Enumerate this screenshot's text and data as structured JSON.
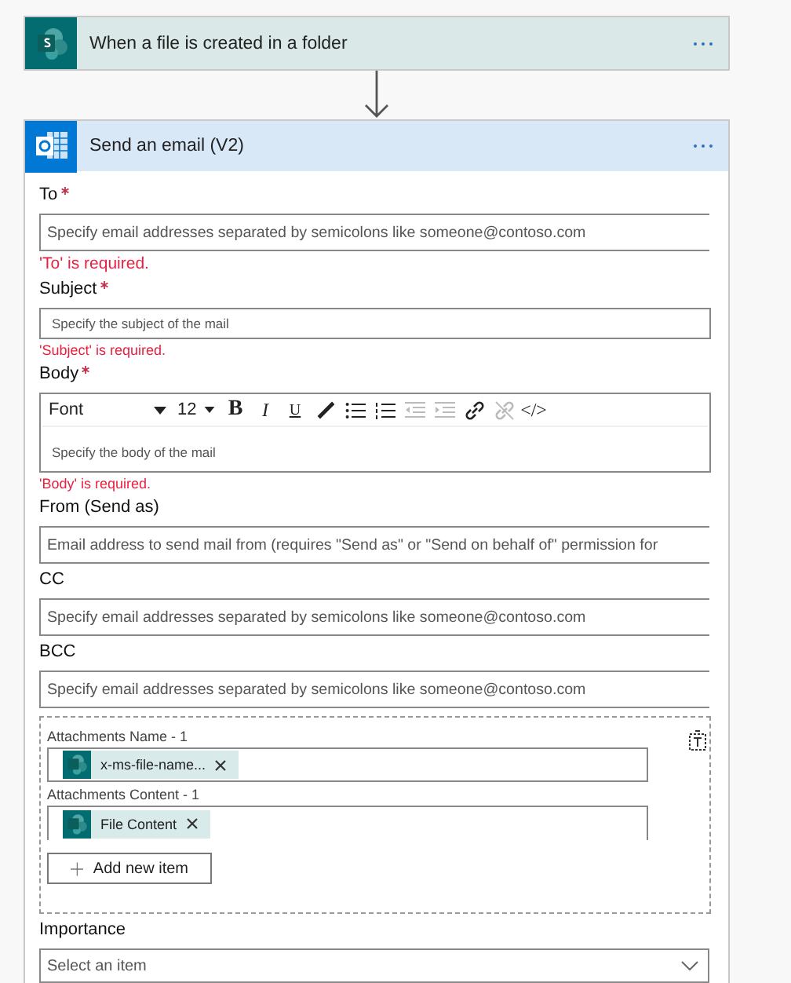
{
  "trigger": {
    "title": "When a file is created in a folder"
  },
  "action": {
    "title": "Send an email (V2)"
  },
  "fields": [
    {
      "kind": "text",
      "label": "To",
      "required": true,
      "placeholder": "Specify email addresses separated by semicolons like someone@contoso.com",
      "error": "'To' is required."
    },
    {
      "kind": "text",
      "label": "Subject",
      "required": true,
      "placeholder": "Specify the subject of the mail",
      "error": "'Subject' is required."
    },
    {
      "kind": "rich",
      "label": "Body",
      "required": true,
      "font": "Font",
      "size": "12",
      "buttons": [
        {
          "label": "B",
          "disabled": false
        },
        {
          "label": "I",
          "disabled": false
        },
        {
          "label": "U",
          "disabled": false
        },
        {
          "disabled": false
        },
        {
          "disabled": false
        },
        {
          "disabled": false
        },
        {
          "disabled": true
        },
        {
          "disabled": true
        },
        {
          "disabled": false
        },
        {
          "disabled": true
        },
        {
          "label": "</>",
          "disabled": false
        }
      ],
      "placeholder": "Specify the body of the mail",
      "error": "'Body' is required."
    },
    {
      "kind": "text",
      "label": "From (Send as)",
      "required": false,
      "placeholder": "Email address to send mail from (requires \"Send as\" or \"Send on behalf of\" permission for"
    },
    {
      "kind": "text",
      "label": "CC",
      "required": false,
      "placeholder": "Specify email addresses separated by semicolons like someone@contoso.com"
    },
    {
      "kind": "text",
      "label": "BCC",
      "required": false,
      "placeholder": "Specify email addresses separated by semicolons like someone@contoso.com"
    },
    {
      "kind": "array",
      "items": [
        {
          "label": "Attachments Name - 1",
          "token": "x-ms-file-name..."
        },
        {
          "label": "Attachments Content - 1",
          "token": "File Content"
        }
      ],
      "add": "Add new item"
    },
    {
      "kind": "select",
      "label": "Importance",
      "required": false,
      "placeholder": "Select an item"
    }
  ]
}
